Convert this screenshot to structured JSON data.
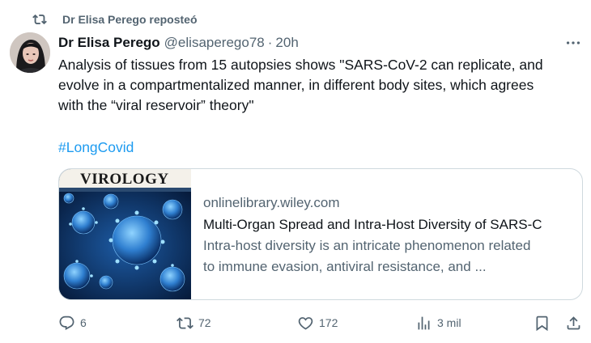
{
  "repost": {
    "icon": "repost-icon",
    "label": "Dr Elisa Perego reposteó"
  },
  "tweet": {
    "author_name": "Dr Elisa Perego",
    "handle": "@elisaperego78",
    "separator": "·",
    "time": "20h",
    "text_lines": [
      "Analysis of tissues from 15 autopsies shows \"SARS-CoV-2 can replicate, and",
      "evolve in a compartmentalized manner, in different body sites, which agrees",
      "with the “viral reservoir” theory\""
    ],
    "hashtag": "#LongCovid"
  },
  "card": {
    "image_journal_title": "VIROLOGY",
    "domain": "onlinelibrary.wiley.com",
    "title": "Multi-Organ Spread and Intra-Host Diversity of SARS-C",
    "description_lines": [
      "Intra-host diversity is an intricate phenomenon related",
      "to immune evasion, antiviral resistance, and ..."
    ]
  },
  "actions": {
    "replies": "6",
    "reposts": "72",
    "likes": "172",
    "views": "3 mil"
  },
  "colors": {
    "text": "#0f1419",
    "secondary": "#536471",
    "link": "#1d9bf0",
    "border": "#cfd9de"
  }
}
